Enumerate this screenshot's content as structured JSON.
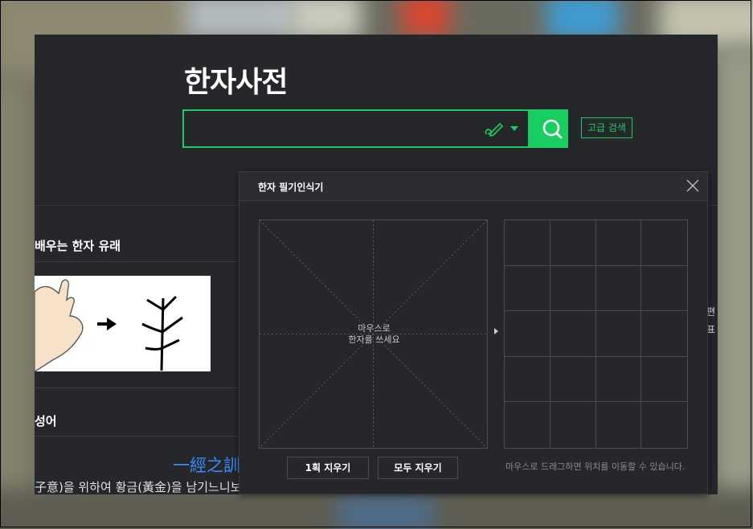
{
  "header": {
    "title": "한자사전",
    "search_placeholder": "",
    "advanced_search_label": "고급 검색"
  },
  "sections": {
    "origin_title": "배우는 한자 유래",
    "idiom_title": "성어",
    "idiom_link": "一經之訓",
    "body_text": "子意)을 위하여 황금(黃金)을 남기느니보다 경서(經書) 한 권(卷)을 가르치는 것이 나음을",
    "right_text_1": "편",
    "right_text_2": "표"
  },
  "handwriting": {
    "title": "한자 필기인식기",
    "pad_hint_line1": "마우스로",
    "pad_hint_line2": "한자를 쓰세요",
    "erase_one_label": "1획 지우기",
    "erase_all_label": "모두 지우기",
    "drag_hint": "마우스로 드래그하면 위치를 이동할 수 있습니다."
  },
  "colors": {
    "accent": "#19ce60",
    "link": "#3b8bff",
    "page_bg": "#26272b"
  },
  "icons": {
    "search": "search-icon",
    "pen": "pen-icon",
    "close": "close-icon",
    "dropdown": "chevron-down-icon"
  }
}
